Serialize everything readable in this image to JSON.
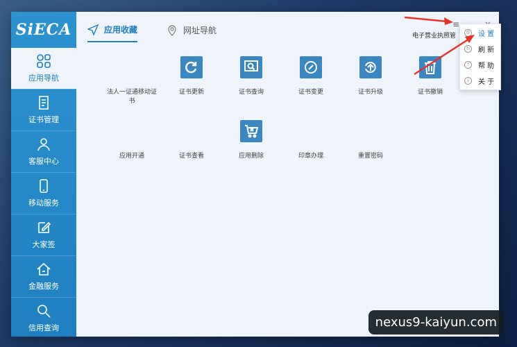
{
  "brand": {
    "logo": "SiECA"
  },
  "sidebar": {
    "items": [
      {
        "label": "应用导航",
        "icon": "grid-icon"
      },
      {
        "label": "证书管理",
        "icon": "document-icon"
      },
      {
        "label": "客服中心",
        "icon": "person-icon"
      },
      {
        "label": "移动服务",
        "icon": "phone-icon"
      },
      {
        "label": "大家签",
        "icon": "edit-icon"
      },
      {
        "label": "金融服务",
        "icon": "home-icon"
      },
      {
        "label": "信用查询",
        "icon": "search-icon"
      }
    ]
  },
  "tabs": [
    {
      "label": "应用收藏",
      "icon": "send-icon"
    },
    {
      "label": "网址导航",
      "icon": "location-icon"
    }
  ],
  "header_right_text": "电子营业执照管",
  "window_controls": {
    "menu": "≡",
    "minimize": "–",
    "close": "×"
  },
  "apps_row1": [
    {
      "label": "法人一证通移动证书",
      "icon": ""
    },
    {
      "label": "证书更新",
      "icon": "refresh-icon"
    },
    {
      "label": "证书查询",
      "icon": "search-icon"
    },
    {
      "label": "证书变更",
      "icon": "edit-icon"
    },
    {
      "label": "证书升级",
      "icon": "upgrade-icon"
    },
    {
      "label": "证书撤销",
      "icon": "trash-icon"
    }
  ],
  "apps_row2": [
    {
      "label": "应用开通",
      "icon": ""
    },
    {
      "label": "证书查看",
      "icon": ""
    },
    {
      "label": "应用删除",
      "icon": "cart-remove-icon"
    },
    {
      "label": "印章办理",
      "icon": ""
    },
    {
      "label": "重置密码",
      "icon": ""
    }
  ],
  "dropdown": {
    "items": [
      "设 置",
      "刷 新",
      "帮 助",
      "关 于"
    ]
  },
  "watermark": "nexus9-kaiyun.com",
  "colors": {
    "accent": "#1f7fc0",
    "sidebar": "#2c93cf",
    "tile": "#3a87c2",
    "arrow": "#e8332a"
  }
}
